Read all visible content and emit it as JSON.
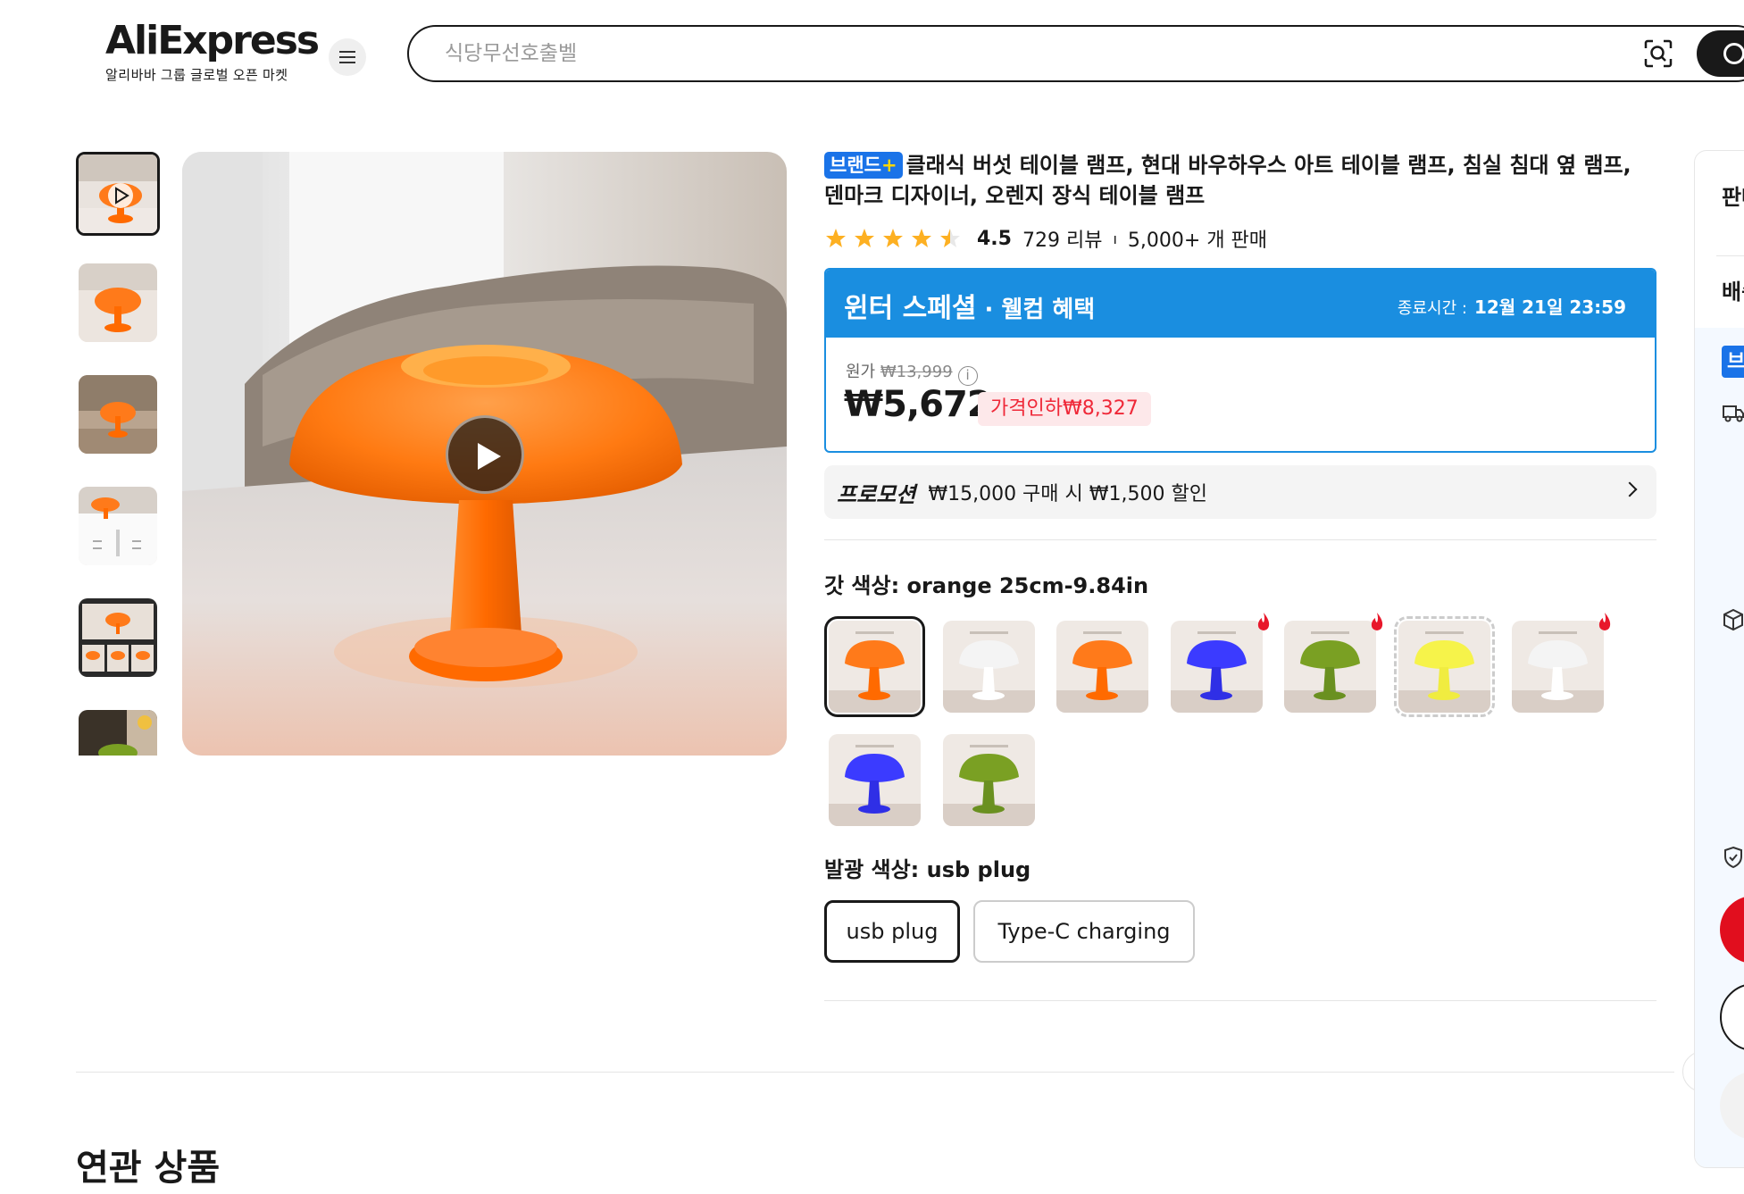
{
  "header": {
    "logo_text": "AliExpress",
    "logo_sub": "알리바바 그룹 글로벌 오픈 마켓",
    "search_placeholder": "식당무선호출벨"
  },
  "product": {
    "brand_badge": "브랜드",
    "brand_plus": "+",
    "title": "클래식 버섯 테이블 램프, 현대 바우하우스 아트 테이블 램프, 침실 침대 옆 램프, 덴마크 디자이너, 오렌지 장식 테이블 램프",
    "rating_score": "4.5",
    "reviews": "729 리뷰",
    "rating_sep": "ı",
    "sold": "5,000+ 개 판매",
    "stars_filled": 4.5
  },
  "promo": {
    "name": "윈터 스페셜",
    "name_sub": " · 웰컴 혜택",
    "end_label": "종료시간 :",
    "end_time": "12월 21일 23:59",
    "orig_label": "원가",
    "orig_price": "₩13,999",
    "price": "₩5,672",
    "discount": "가격인하₩8,327"
  },
  "coupon": {
    "tag": "프로모션",
    "text": "₩15,000 구매 시 ₩1,500 할인"
  },
  "options": {
    "shade_label": "갓 색상: orange 25cm-9.84in",
    "light_label": "발광 색상: usb plug",
    "swatches": [
      {
        "color": "#ff7a1a",
        "stem": "#ff6a00",
        "active": true,
        "hot": false
      },
      {
        "color": "#f4f4f4",
        "stem": "#ffffff",
        "active": false,
        "hot": false
      },
      {
        "color": "#ff7a1a",
        "stem": "#ff6a00",
        "active": false,
        "hot": false
      },
      {
        "color": "#3b3bff",
        "stem": "#2f2fe6",
        "active": false,
        "hot": true
      },
      {
        "color": "#7aa023",
        "stem": "#6a9020",
        "active": false,
        "hot": true
      },
      {
        "color": "#f6f34a",
        "stem": "#f0ec40",
        "active": false,
        "hot": false,
        "dashed": true
      },
      {
        "color": "#f4f4f4",
        "stem": "#ffffff",
        "active": false,
        "hot": true
      },
      {
        "color": "#3b3bff",
        "stem": "#2f2fe6",
        "active": false,
        "hot": false
      },
      {
        "color": "#7aa023",
        "stem": "#6a9020",
        "active": false,
        "hot": false
      }
    ],
    "chips": [
      "usb plug",
      "Type-C charging"
    ]
  },
  "related_title": "연관 상품",
  "side_panel": {
    "t1": "판매",
    "t2": "배송",
    "brand_mini": "브"
  },
  "colors": {
    "accent_blue": "#1a8ee0",
    "discount_red": "#ef2838",
    "star": "#fdb022"
  }
}
